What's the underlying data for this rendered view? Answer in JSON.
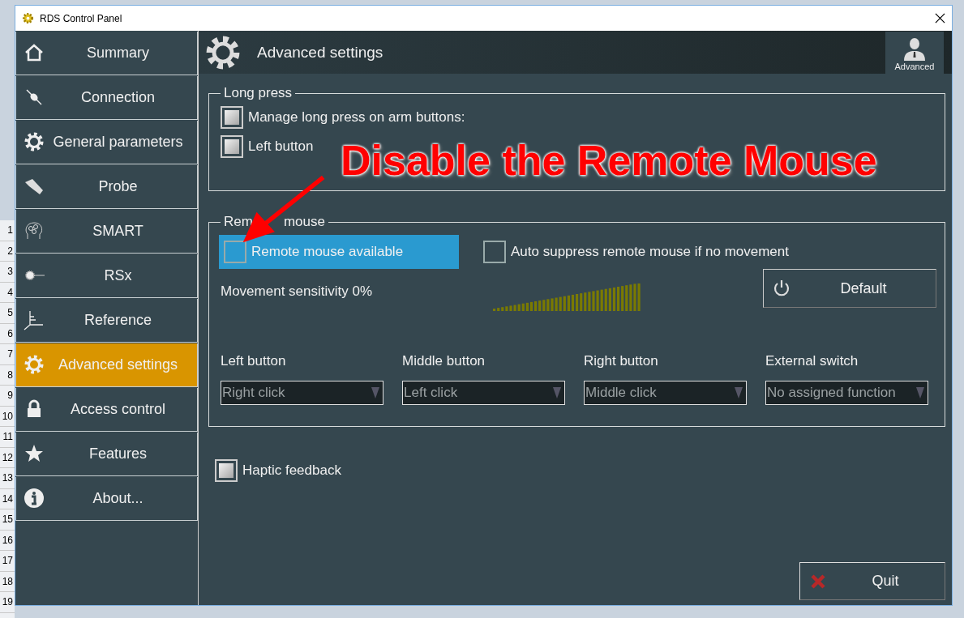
{
  "background_rows": [
    "1",
    "2",
    "3",
    "4",
    "5",
    "6",
    "7",
    "8",
    "9",
    "10",
    "11",
    "12",
    "13",
    "14",
    "15",
    "16",
    "17",
    "18",
    "19"
  ],
  "window": {
    "title": "RDS Control Panel"
  },
  "sidebar": {
    "items": [
      {
        "label": "Summary",
        "kind": "home",
        "selected": false
      },
      {
        "label": "Connection",
        "kind": "plug",
        "selected": false
      },
      {
        "label": "General parameters",
        "kind": "gear",
        "selected": false
      },
      {
        "label": "Probe",
        "kind": "probe",
        "selected": false
      },
      {
        "label": "SMART",
        "kind": "brain",
        "selected": false
      },
      {
        "label": "RSx",
        "kind": "laser",
        "selected": false
      },
      {
        "label": "Reference",
        "kind": "axes",
        "selected": false
      },
      {
        "label": "Advanced settings",
        "kind": "gear",
        "selected": true
      },
      {
        "label": "Access control",
        "kind": "lock",
        "selected": false
      },
      {
        "label": "Features",
        "kind": "star",
        "selected": false
      },
      {
        "label": "About...",
        "kind": "info",
        "selected": false
      }
    ]
  },
  "header": {
    "title": "Advanced settings",
    "profile": "Advanced"
  },
  "long_press": {
    "legend": "Long press",
    "options": [
      {
        "label": "Manage long press on arm buttons:",
        "checked": false,
        "disabled": true
      },
      {
        "label": "Left button",
        "checked": false,
        "disabled": true
      }
    ]
  },
  "remote_mouse": {
    "legend_parts": [
      "Rem",
      "mouse"
    ],
    "available": {
      "label": "Remote mouse available",
      "checked": false,
      "disabled": false,
      "highlighted": true
    },
    "auto_suppress": {
      "label": "Auto suppress remote mouse if no movement",
      "checked": false,
      "disabled": false
    },
    "sensitivity": {
      "label": "Movement sensitivity 0%"
    },
    "default_button": "Default",
    "assignments": [
      {
        "label": "Left button",
        "value": "Right click"
      },
      {
        "label": "Middle button",
        "value": "Left click"
      },
      {
        "label": "Right button",
        "value": "Middle click"
      },
      {
        "label": "External switch",
        "value": "No assigned function"
      }
    ]
  },
  "haptic": {
    "label": "Haptic feedback",
    "checked": false,
    "disabled": true
  },
  "quit_button": "Quit",
  "annotation": {
    "text": "Disable the Remote Mouse"
  }
}
